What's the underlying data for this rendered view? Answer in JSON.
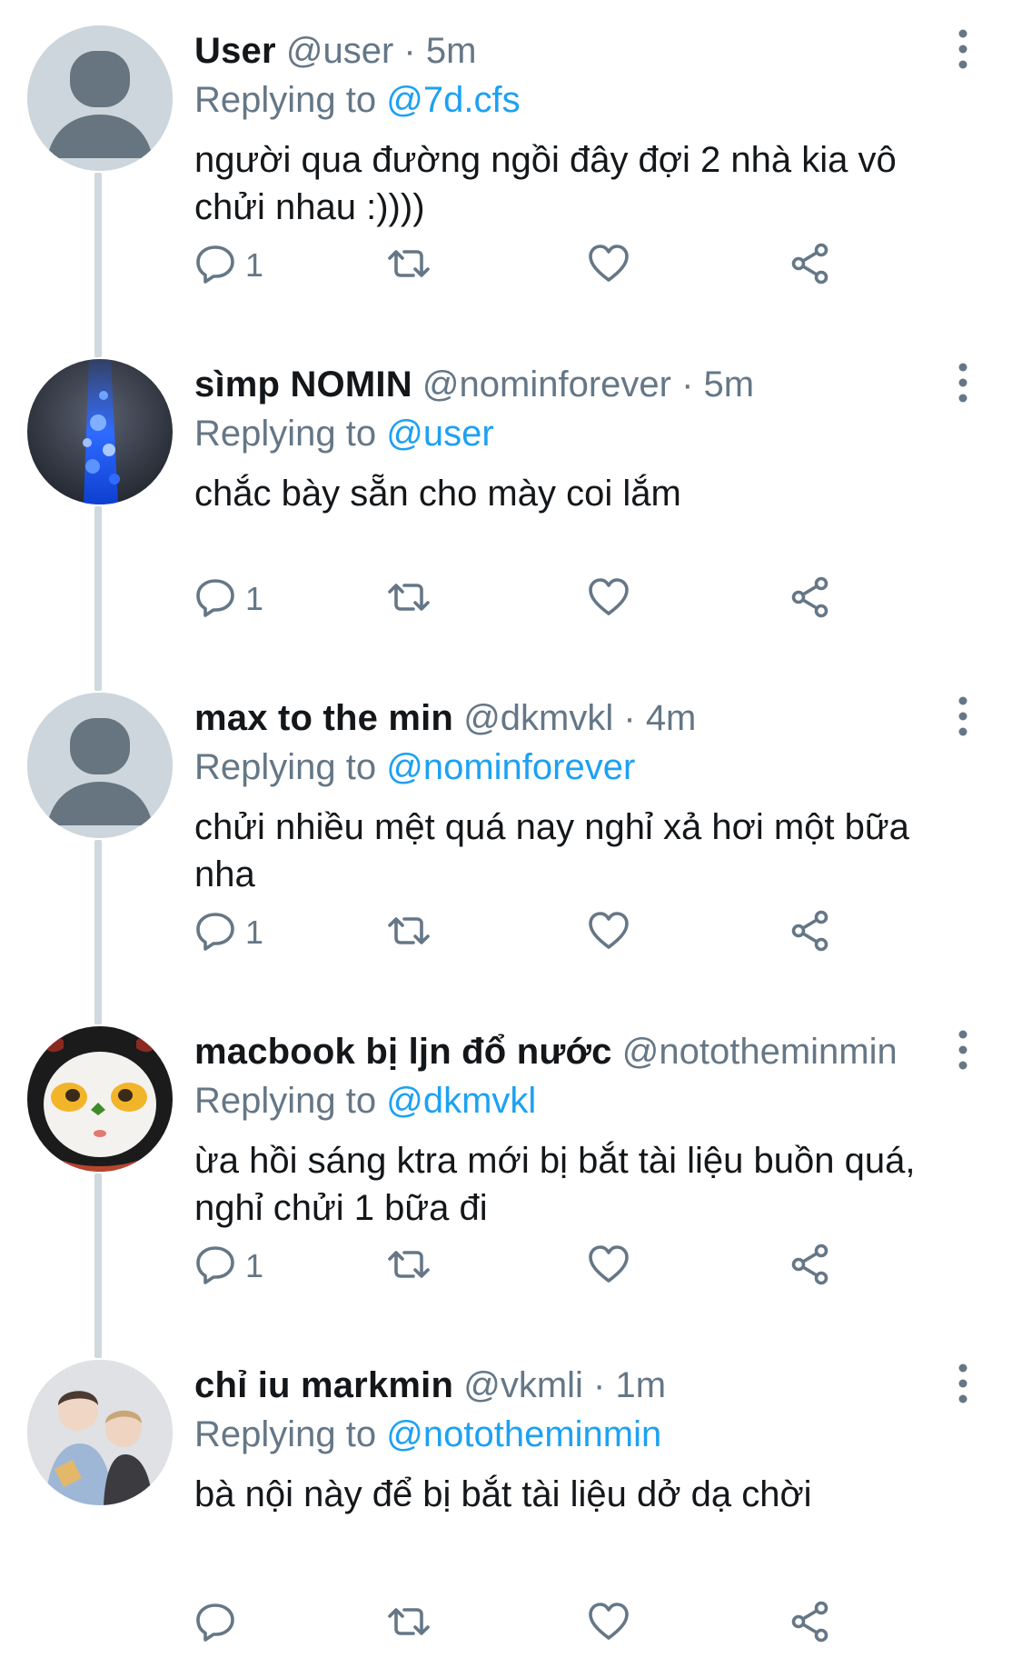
{
  "reply_prefix": "Replying to",
  "tweets": [
    {
      "display_name": "User",
      "handle": "@user",
      "separator": "·",
      "time": "5m",
      "replying_to": "@7d.cfs",
      "text": "người qua đường ngồi đây đợi 2 nhà kia vô chửi nhau :))))",
      "reply_count": "1",
      "avatar": "default-avatar"
    },
    {
      "display_name": "sìmp NOMIN",
      "handle": "@nominforever",
      "separator": "·",
      "time": "5m",
      "replying_to": "@user",
      "text": "chắc bày sẵn cho mày coi lắm",
      "reply_count": "1",
      "avatar": "blue-light-photo"
    },
    {
      "display_name": "max to the min",
      "handle": "@dkmvkl",
      "separator": "·",
      "time": "4m",
      "replying_to": "@nominforever",
      "text": "chửi nhiều mệt quá nay nghỉ xả hơi một bữa nha",
      "reply_count": "1",
      "avatar": "default-avatar"
    },
    {
      "display_name": "macbook bị ljn đổ nước",
      "handle": "@nototheminmin…",
      "separator": "",
      "time": "",
      "replying_to": "@dkmvkl",
      "text": "ừa hồi sáng ktra mới bị bắt tài liệu buồn quá, nghỉ chửi 1 bữa đi",
      "reply_count": "1",
      "avatar": "egg-face-photo"
    },
    {
      "display_name": "chỉ iu markmin",
      "handle": "@vkmli",
      "separator": "·",
      "time": "1m",
      "replying_to": "@nototheminmin",
      "text": "bà nội này để bị bắt tài liệu dở dạ chời",
      "reply_count": "",
      "avatar": "two-people-photo"
    }
  ],
  "colors": {
    "name": "#14171a",
    "meta": "#657786",
    "mention": "#1da1f2",
    "icon": "#657786",
    "thread_line": "#cfd9de",
    "avatar_bg": "#cdd6dd",
    "avatar_fg": "#66757f"
  },
  "icons": {
    "reply": "reply-icon",
    "retweet": "retweet-icon",
    "like": "heart-icon",
    "share": "share-icon",
    "more": "more-vertical-icon"
  }
}
